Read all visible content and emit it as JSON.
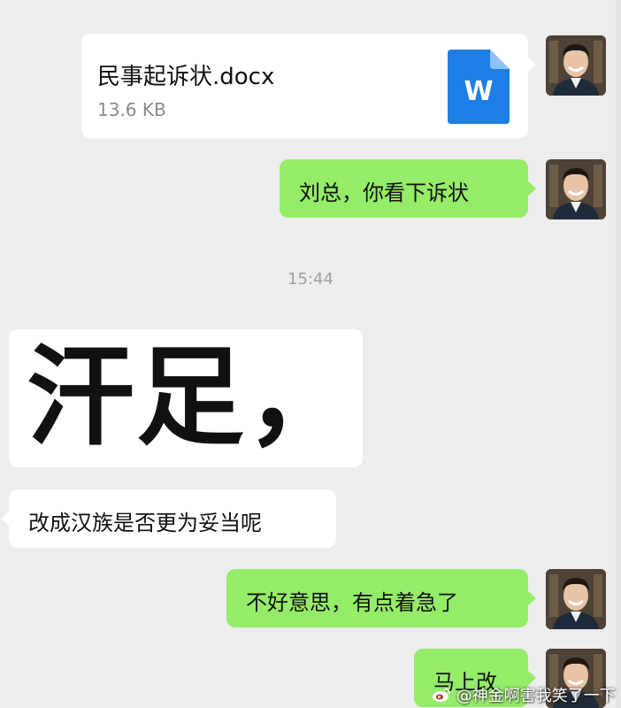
{
  "colors": {
    "background": "#ededed",
    "green_bubble": "#95ec69",
    "white_bubble": "#ffffff",
    "doc_icon": "#1e7ee6"
  },
  "messages": [
    {
      "side": "right",
      "type": "file",
      "file_name": "民事起诉状.docx",
      "file_size": "13.6 KB",
      "icon": "word-document-icon",
      "icon_letter": "W"
    },
    {
      "side": "right",
      "type": "text",
      "text": "刘总，你看下诉状"
    },
    {
      "type": "time",
      "text": "15:44"
    },
    {
      "side": "left",
      "type": "sticker",
      "text": "汗足，"
    },
    {
      "side": "left",
      "type": "text",
      "text": "改成汉族是否更为妥当呢"
    },
    {
      "side": "right",
      "type": "text",
      "text": "不好意思，有点着急了"
    },
    {
      "side": "right",
      "type": "text",
      "text": "马上改"
    }
  ],
  "watermark": "@神金啊害我笑了一下"
}
